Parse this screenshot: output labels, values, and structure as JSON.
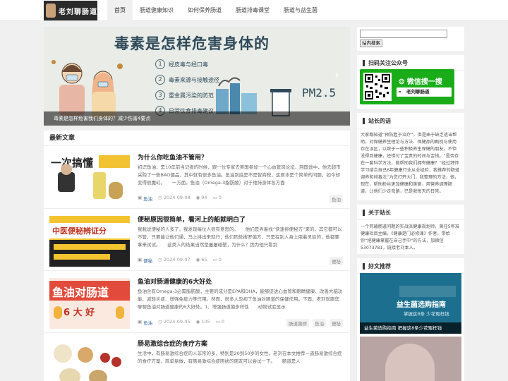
{
  "logo": {
    "text": "老刘聊肠道"
  },
  "nav": [
    {
      "label": "首页",
      "active": true
    },
    {
      "label": "肠道健康知识",
      "active": false
    },
    {
      "label": "如何保养肠道",
      "active": false
    },
    {
      "label": "肠道排毒课堂",
      "active": false
    },
    {
      "label": "肠道与益生菌",
      "active": false
    }
  ],
  "banner": {
    "title": "毒素是怎样危害身体的",
    "steps": [
      {
        "num": "1",
        "text": "经皮毒与经口毒"
      },
      {
        "num": "2",
        "text": "毒素来源与接触途径"
      },
      {
        "num": "3",
        "text": "重金属污染的防范"
      },
      {
        "num": "4",
        "text": "日常饮食排毒建议"
      }
    ],
    "pm": "PM2.5",
    "caption": "毒素是怎样危害我们身体的？减少伤害4要点"
  },
  "latest": {
    "heading": "最新文章",
    "posts": [
      {
        "title": "为什么你吃鱼油不管用？",
        "excerpt": "初识鱼油，是10年前当记者的时候，跟一位专家去美国参加一个心血管岗论坛，回国途中，他去超市采购了一些BAO健品，其中就有很多鱼油。鱼油到底是不是智商税，这原本是个简单的问题，如今却变得很魔幻。　　一方面，鱼油（Omega-3脂肪酸）对于维持身体各方面",
        "category": "鱼油",
        "date": "2024-09-08",
        "views": "94",
        "comments": "0",
        "tags": [
          "鱼油"
        ],
        "thumb_text": "一次搞懂"
      },
      {
        "title": "便秘原因很简单，看河上的船就明白了",
        "excerpt": "我我说便秘的人多了，我发现每位人很有意思的。　　他们是弄着找“快速排便秘方”来的，其它都可以不管，只要能让他们通，马上排出来就行；他们四处搜罗偏方，只是在别人身上用着灵验的，他都要拿来试试。　　这类人的结果当然是屡屡碰壁，为什么？因为他只看到",
        "category": "便秘",
        "date": "2024-09-07",
        "views": "65",
        "comments": "0",
        "tags": [
          "便秘"
        ],
        "thumb_text": "中医便秘辨证分"
      },
      {
        "title": "鱼油对肠道健康的6大好处",
        "excerpt": "鱼油含有Omega-3必需脂肪酸，主要的成分是EPA和DHA，能够促进心血管和眼睛健康、改善大脑功能、减轻炎症、增强免疫力等作用。然而，很多人忽视了鱼油对肠道的保健作用。下面，老刘就跟您聊聊鱼油对肠道健康的6大好处。1、增强肠道菌多样性　　动物试验显示",
        "category": "鱼油",
        "date": "2024-09-05",
        "views": "105",
        "comments": "0",
        "tags": [
          "肠道菌群",
          "鱼油",
          "便秘"
        ],
        "thumb_text": "鱼油对肠道"
      },
      {
        "title": "肠易激综合症的食疗方案",
        "excerpt": "生活中，有肠易激综合症的人非常的多，特别是20到50岁的女性。老刘在本文推荐一道肠易激综合症的食疗方案，简单易做，有肠易激综合症困扰的朋友可以尝试一下。　　肠道是人",
        "category": "",
        "date": "",
        "views": "",
        "comments": "",
        "tags": [],
        "thumb_text": ""
      }
    ]
  },
  "sidebar": {
    "search": {
      "placeholder": "",
      "button": "站内搜索"
    },
    "wechat": {
      "heading": "扫码关注公众号",
      "banner": "微信搜一搜",
      "account": "老刘聊肠道"
    },
    "site_words": {
      "heading": "站长的话",
      "text": "大家都知道“预防胜于治疗”，但是由于缺乏适当帮助，对保健养生理论与方法、保健品的甄别与使用存在误区，以致于一些积极养生保健的朋友，不但没得到健康，还错付了宝贵的时间与金钱。“是否存在一套科学方法，能帮助我们拥有健康？”经过拜师学习结合自己6年健康行业从业经验，我推荐的肠道调养和排毒法”为您打开大门、我整理的方法，很，现在，帮助粉丝更加健康和美丽，用营养调理肠道，让他们少走弯路，已是我每天的日常。"
    },
    "about": {
      "heading": "关于站长",
      "text": "一个死磕肠道问题的实战派健康规划师，曾任5年准健康栏目主编，《健康是门必修课》作者，带给你“把健康掌握在自己手中”的方法，加微信53073781，链接老刘本人。"
    },
    "friends": {
      "heading": "好文推荐",
      "items": [
        {
          "title": "益生菌选购指南",
          "sub": "掌握这8条 少花冤枉钱",
          "caption": "益生菌选购指南 把握这8条少花冤枉钱"
        }
      ]
    }
  }
}
